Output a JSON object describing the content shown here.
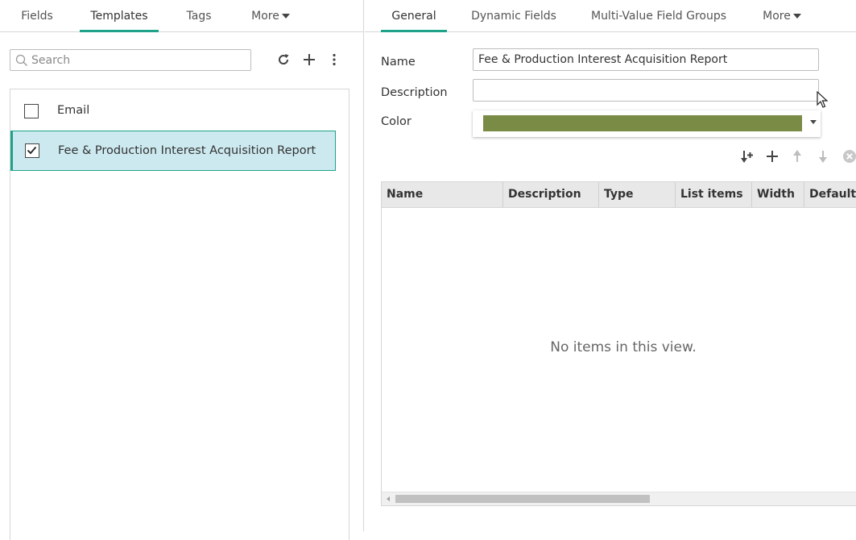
{
  "left_tabs": [
    {
      "label": "Fields"
    },
    {
      "label": "Templates"
    },
    {
      "label": "Tags"
    },
    {
      "label": "More"
    }
  ],
  "right_tabs": [
    {
      "label": "General"
    },
    {
      "label": "Dynamic Fields"
    },
    {
      "label": "Multi-Value Field Groups"
    },
    {
      "label": "More"
    }
  ],
  "search": {
    "placeholder": "Search",
    "value": ""
  },
  "templates": [
    {
      "label": "Email",
      "checked": false
    },
    {
      "label": "Fee & Production Interest Acquisition Report",
      "checked": true
    }
  ],
  "form": {
    "name_label": "Name",
    "name_value": "Fee & Production Interest Acquisition Report",
    "description_label": "Description",
    "description_value": "",
    "color_label": "Color",
    "color_value": "#7a8b46"
  },
  "grid": {
    "columns": [
      "Name",
      "Description",
      "Type",
      "List items",
      "Width",
      "Default v"
    ],
    "empty_text": "No items in this view."
  },
  "colors": {
    "accent": "#1ea38a",
    "selected_bg": "#cce9ef",
    "swatch": "#7a8b46"
  }
}
